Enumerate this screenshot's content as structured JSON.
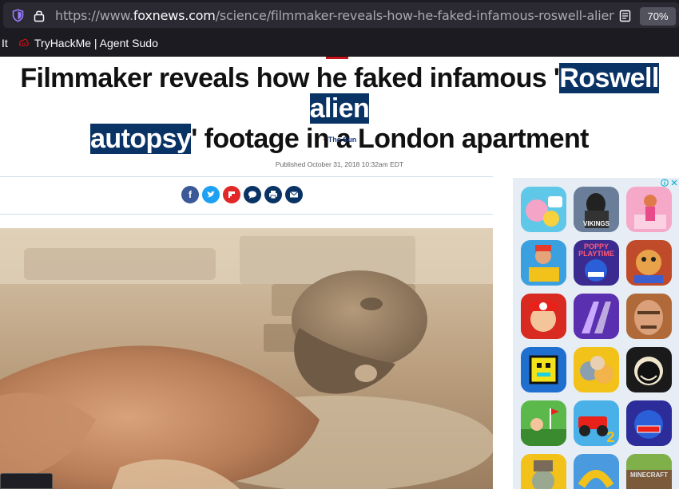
{
  "browser": {
    "url_prefix": "https://www.",
    "url_domain": "foxnews.com",
    "url_path": "/science/filmmaker-reveals-how-he-faked-infamous-roswell-alien-autopsy",
    "zoom": "70%",
    "bookmarks": [
      {
        "label": "It"
      },
      {
        "label": "TryHackMe | Agent Sudo"
      }
    ]
  },
  "article": {
    "headline_part1": "Filmmaker reveals how he faked infamous '",
    "headline_highlight_1": "Roswell alien ",
    "headline_highlight_2": "autopsy",
    "headline_part2": "' footage in a London apartment",
    "source": "The Sun",
    "published": "Published October 31, 2018 10:32am EDT",
    "share_buttons": [
      {
        "icon": "facebook-icon",
        "glyph": "f",
        "color": "#3b5998"
      },
      {
        "icon": "twitter-icon",
        "glyph": "t",
        "color": "#1da1f2"
      },
      {
        "icon": "flipboard-icon",
        "glyph": "F",
        "color": "#e12828"
      },
      {
        "icon": "comment-icon",
        "glyph": "●",
        "color": "#0a3365"
      },
      {
        "icon": "print-icon",
        "glyph": "⎙",
        "color": "#0a3365"
      },
      {
        "icon": "email-icon",
        "glyph": "✉",
        "color": "#0a3365"
      }
    ]
  },
  "ad": {
    "tiles": [
      {
        "name": "toca-world",
        "bg": "#5fc7e8",
        "label": ""
      },
      {
        "name": "vikings",
        "bg": "#6a7e9a",
        "label": "VIKINGS"
      },
      {
        "name": "runner-girl",
        "bg": "#f5a8c8",
        "label": ""
      },
      {
        "name": "subway-surfers",
        "bg": "#3aa0e0",
        "label": ""
      },
      {
        "name": "poppy-playtime",
        "bg": "#3b2a8f",
        "label": "POPPY PLAYTIME"
      },
      {
        "name": "kick-the-buddy",
        "bg": "#c04b2a",
        "label": ""
      },
      {
        "name": "super-mario",
        "bg": "#d82a20",
        "label": ""
      },
      {
        "name": "tiles-hop",
        "bg": "#5a2fb0",
        "label": ""
      },
      {
        "name": "hello-neighbor",
        "bg": "#b06a3a",
        "label": ""
      },
      {
        "name": "geometry-dash",
        "bg": "#1f6fd0",
        "label": ""
      },
      {
        "name": "talking-tom",
        "bg": "#f2c21a",
        "label": ""
      },
      {
        "name": "bendy",
        "bg": "#1a1a1a",
        "label": ""
      },
      {
        "name": "golf-game",
        "bg": "#5bb84a",
        "label": ""
      },
      {
        "name": "hill-climb-2",
        "bg": "#4ab0e8",
        "label": "2"
      },
      {
        "name": "huggy-wuggy",
        "bg": "#2c2c9a",
        "label": ""
      },
      {
        "name": "plants-vs-zombies",
        "bg": "#f2c21a",
        "label": ""
      },
      {
        "name": "snake-io",
        "bg": "#4a9ae0",
        "label": ""
      },
      {
        "name": "minecraft",
        "bg": "#6b8e3c",
        "label": "MINECRAFT"
      }
    ]
  }
}
